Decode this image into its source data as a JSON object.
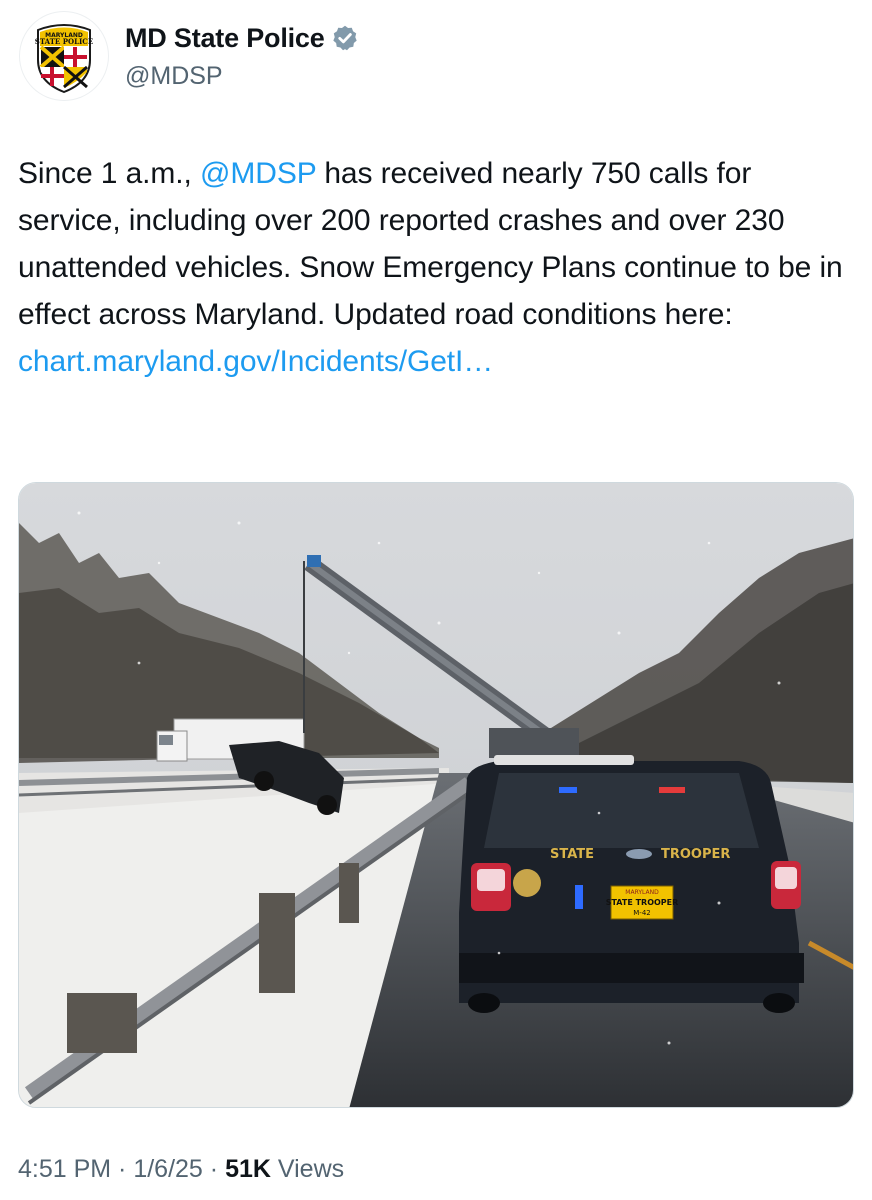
{
  "author": {
    "display_name": "MD State Police",
    "handle": "@MDSP",
    "avatar_text_top": "MARYLAND",
    "avatar_text_mid": "STATE POLICE",
    "verified": true
  },
  "tweet": {
    "text_1": "Since 1 a.m., ",
    "mention": "@MDSP",
    "text_2": " has received nearly 750 calls for service, including over 200 reported crashes and over 230 unattended vehicles. Snow Emergency Plans continue to be in effect across Maryland. Updated road conditions here: ",
    "link": "chart.maryland.gov/Incidents/GetI…"
  },
  "media": {
    "trunk_left": "STATE",
    "trunk_right": "TROOPER",
    "plate_top": "MARYLAND",
    "plate_mid": "STATE TROOPER",
    "plate_bottom": "M-42"
  },
  "meta": {
    "time": "4:51 PM",
    "sep": " · ",
    "date": "1/6/25",
    "views_count": "51K",
    "views_label": " Views"
  },
  "colors": {
    "link": "#1d9bf0",
    "secondary_text": "#536471",
    "primary_text": "#0f1419"
  }
}
